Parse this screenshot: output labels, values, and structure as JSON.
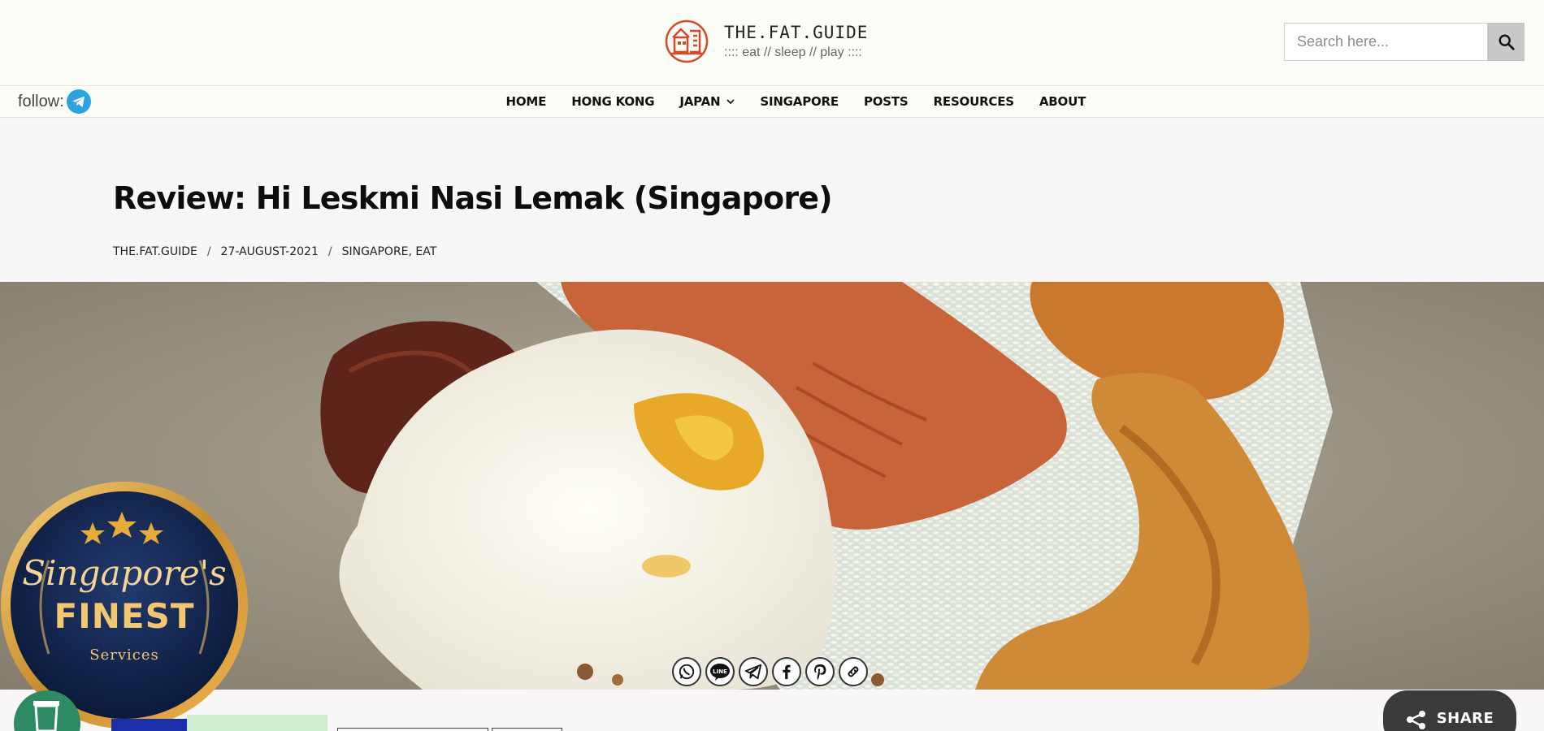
{
  "header": {
    "site_title": "THE.FAT.GUIDE",
    "tagline": ":::: eat // sleep // play ::::",
    "logo_icon": "house-logo-icon",
    "brand_color": "#d9482b"
  },
  "search": {
    "placeholder": "Search here...",
    "value": "",
    "button_icon": "search-icon"
  },
  "follow": {
    "label": "follow:",
    "icon": "telegram-icon"
  },
  "nav": {
    "items": [
      {
        "label": "HOME"
      },
      {
        "label": "HONG KONG"
      },
      {
        "label": "JAPAN",
        "has_dropdown": true
      },
      {
        "label": "SINGAPORE"
      },
      {
        "label": "POSTS"
      },
      {
        "label": "RESOURCES"
      },
      {
        "label": "ABOUT"
      }
    ]
  },
  "article": {
    "title": "Review: Hi Leskmi Nasi Lemak (Singapore)",
    "author": "THE.FAT.GUIDE",
    "date": "27-AUGUST-2021",
    "categories": "SINGAPORE, EAT",
    "separator": "/"
  },
  "share_icons": [
    {
      "icon": "whatsapp-icon"
    },
    {
      "icon": "line-icon",
      "label": "LINE"
    },
    {
      "icon": "telegram-icon"
    },
    {
      "icon": "facebook-icon"
    },
    {
      "icon": "pinterest-icon"
    },
    {
      "icon": "link-icon"
    }
  ],
  "badge": {
    "line1": "Singapore's",
    "line2": "FINEST",
    "line3": "Services",
    "stars": 3
  },
  "share_button": {
    "label": "SHARE",
    "icon": "share-icon"
  }
}
